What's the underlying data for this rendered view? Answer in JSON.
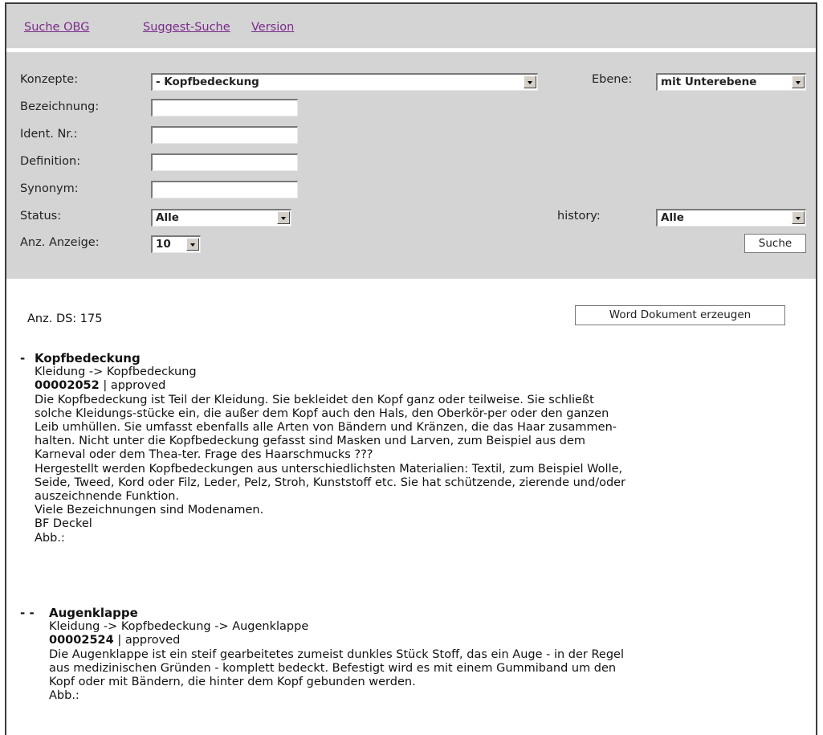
{
  "nav": {
    "links": [
      "Suche OBG",
      "Suggest-Suche",
      "Version"
    ]
  },
  "form": {
    "konzepte_label": "Konzepte:",
    "konzepte_value": "- Kopfbedeckung",
    "ebene_label": "Ebene:",
    "ebene_value": "mit Unterebene",
    "bezeichnung_label": "Bezeichnung:",
    "ident_label": "Ident. Nr.:",
    "definition_label": "Definition:",
    "synonym_label": "Synonym:",
    "status_label": "Status:",
    "status_value": "Alle",
    "history_label": "history:",
    "history_value": "Alle",
    "anzeige_label": "Anz. Anzeige:",
    "anzeige_value": "10",
    "suche_button": "Suche"
  },
  "results": {
    "count_text": "Anz. DS: 175",
    "word_button": "Word Dokument erzeugen",
    "entries": [
      {
        "prefix": "-",
        "title": "Kopfbedeckung",
        "path": "Kleidung -> Kopfbedeckung",
        "id": "00002052",
        "status": "| approved",
        "lines": [
          "Die Kopfbedeckung ist Teil der Kleidung. Sie bekleidet den Kopf ganz oder teilweise. Sie schließt",
          "solche Kleidungs-stücke ein, die außer dem Kopf auch den Hals, den Oberkör-per oder den ganzen",
          "Leib umhüllen. Sie umfasst ebenfalls alle Arten von Bändern und Kränzen, die das Haar zusammen-",
          "halten. Nicht unter die Kopfbedeckung gefasst sind Masken und Larven, zum Beispiel aus dem",
          "Karneval oder dem Thea-ter. Frage des Haarschmucks ???",
          "Hergestellt werden Kopfbedeckungen aus unterschiedlichsten Materialien: Textil, zum Beispiel Wolle,",
          "Seide, Tweed, Kord oder Filz, Leder, Pelz, Stroh, Kunststoff etc. Sie hat schützende, zierende und/oder",
          "auszeichnende Funktion.",
          "Viele Bezeichnungen sind Modenamen.",
          "BF Deckel",
          "Abb.:"
        ]
      },
      {
        "prefix": "- -",
        "title": "Augenklappe",
        "path": "Kleidung -> Kopfbedeckung -> Augenklappe",
        "id": "00002524",
        "status": "| approved",
        "lines": [
          "Die Augenklappe ist ein steif gearbeitetes zumeist dunkles Stück Stoff, das ein Auge - in der Regel",
          "aus medizinischen Gründen - komplett bedeckt. Befestigt wird es mit einem Gummiband um den",
          "Kopf oder mit Bändern, die hinter dem Kopf gebunden werden.",
          "Abb.:"
        ]
      }
    ]
  }
}
